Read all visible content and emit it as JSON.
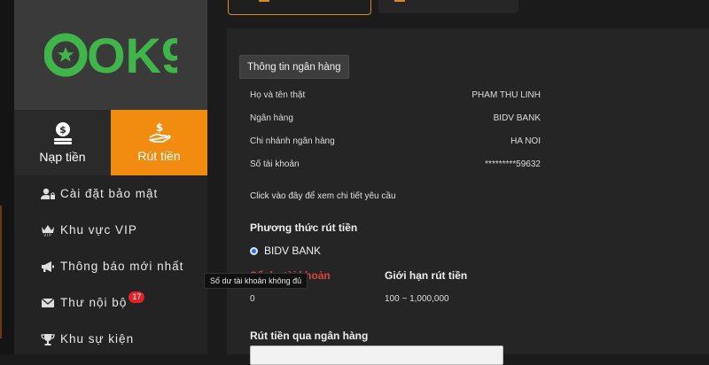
{
  "logo": {
    "text": "OK9",
    "color": "#3fb54a"
  },
  "actions": {
    "deposit": {
      "label": "Nạp tiền",
      "icon": "coin-stack-icon"
    },
    "withdraw": {
      "label": "Rút tiền",
      "icon": "hand-money-icon",
      "color": "#f28c10"
    }
  },
  "menu": [
    {
      "label": "Cài đặt bảo mật",
      "icon": "user-lock-icon"
    },
    {
      "label": "Khu vực VIP",
      "icon": "vip-crown-icon"
    },
    {
      "label": "Thông báo mới nhất",
      "icon": "megaphone-icon"
    },
    {
      "label": "Thư nội bộ",
      "icon": "envelope-icon",
      "badge": "17"
    },
    {
      "label": "Khu sự kiện",
      "icon": "trophy-icon"
    }
  ],
  "tooltip": "Số dư tài khoản không đủ",
  "bank_info": {
    "button": "Thông tin ngân hàng",
    "rows": [
      {
        "key": "Họ và tên thật",
        "value": "PHAM THU LINH"
      },
      {
        "key": "Ngân hàng",
        "value": "BIDV BANK"
      },
      {
        "key": "Chi nhánh ngân hàng",
        "value": "HA NOI"
      },
      {
        "key": "Số tài khoản",
        "value": "*********59632"
      }
    ],
    "details_link": "Click vào đây để xem chi tiết yêu cầu"
  },
  "withdraw_method": {
    "title": "Phương thức rút tiền",
    "option": "BIDV BANK",
    "balance_label": "Số dư tài khoản",
    "balance_value": "0",
    "limit_label": "Giới hạn rút tiền",
    "limit_value": "100 ~ 1,000,000"
  },
  "bank_withdraw": {
    "title": "Rút tiền qua ngân hàng"
  }
}
